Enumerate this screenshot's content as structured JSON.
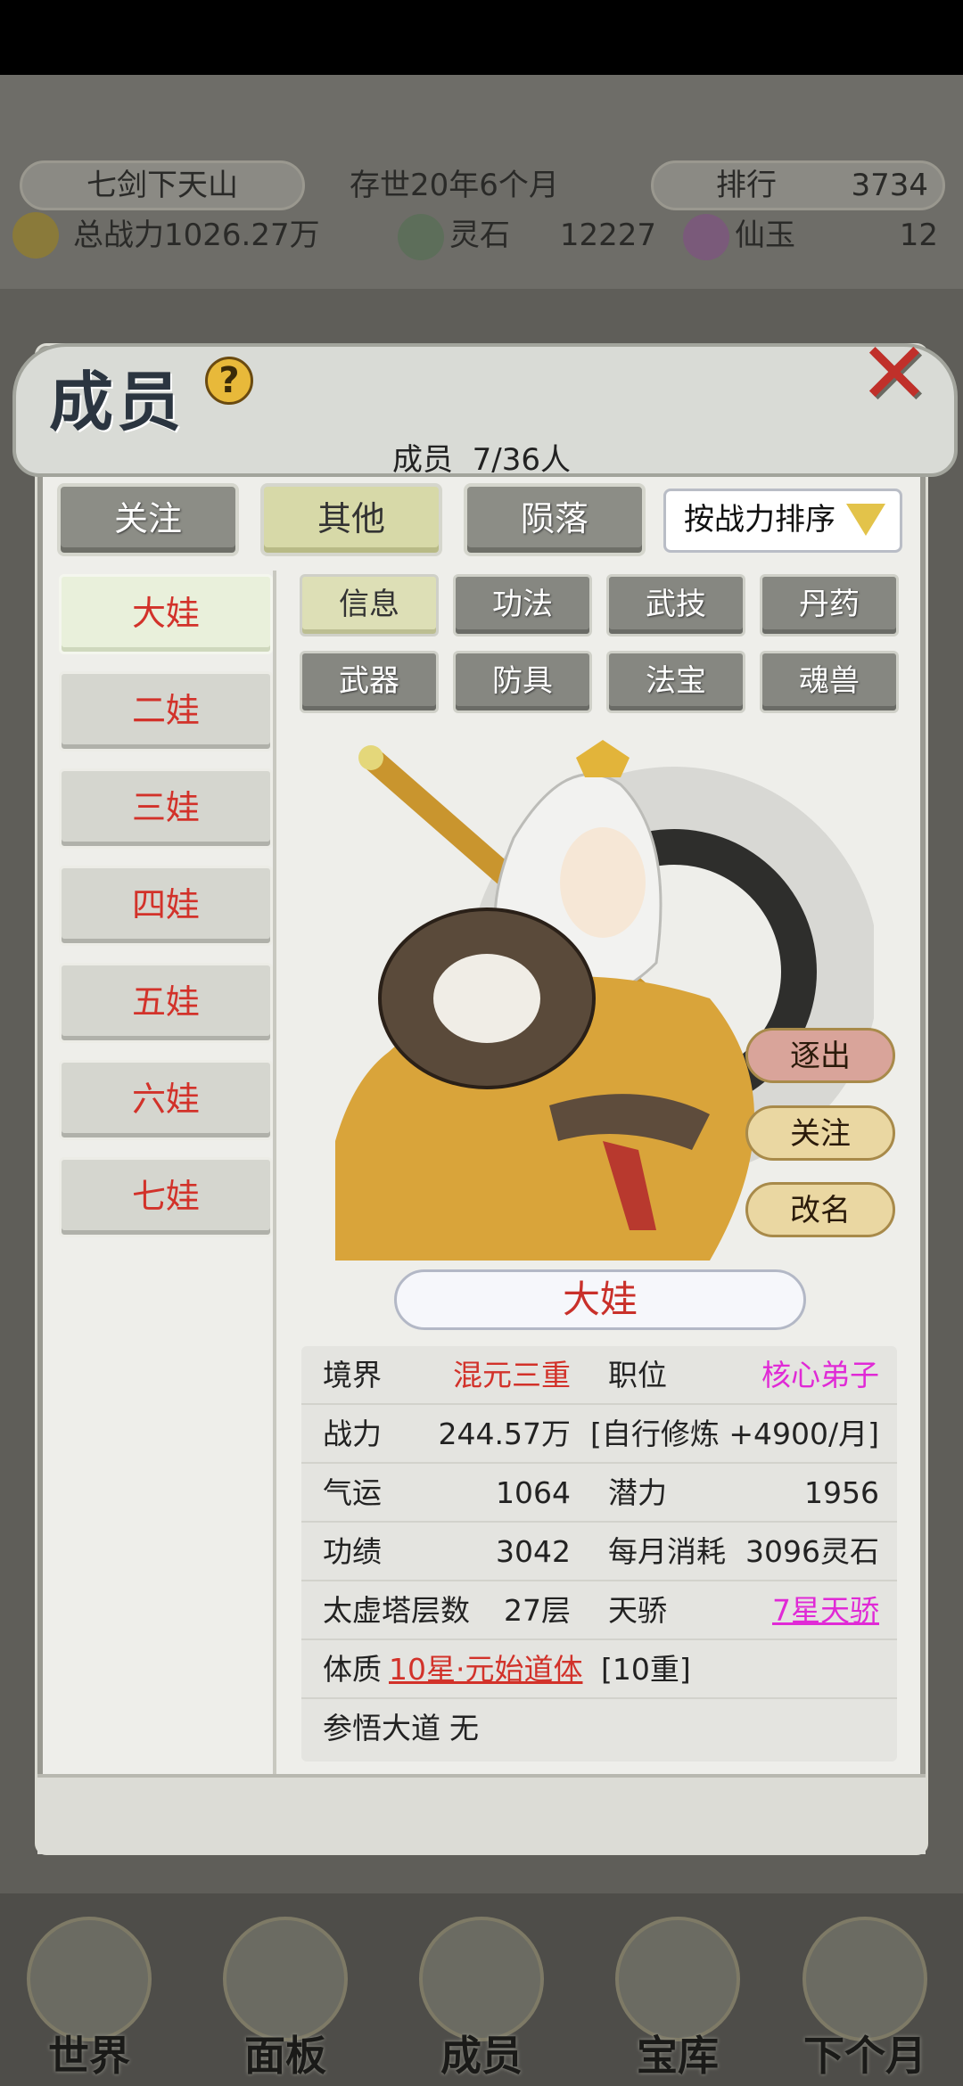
{
  "header": {
    "sect_name": "七剑下天山",
    "age_text": "存世20年6个月",
    "rank_label": "排行",
    "rank_value": "3734",
    "power_label": "总战力1026.27万",
    "spirit_stone_label": "灵石",
    "spirit_stone_value": "12227",
    "jade_label": "仙玉",
    "jade_value": "12"
  },
  "modal": {
    "title": "成员",
    "help": "?",
    "close": "✕",
    "member_count_label": "成员",
    "member_count_value": "7/36人",
    "tabs": [
      {
        "label": "关注"
      },
      {
        "label": "其他"
      },
      {
        "label": "陨落"
      }
    ],
    "selected_tab": "其他",
    "sort_label": "按战力排序",
    "members": [
      "大娃",
      "二娃",
      "三娃",
      "四娃",
      "五娃",
      "六娃",
      "七娃"
    ],
    "selected_member": "大娃",
    "subtabs": [
      "信息",
      "功法",
      "武技",
      "丹药",
      "武器",
      "防具",
      "法宝",
      "魂兽"
    ],
    "selected_subtab": "信息",
    "actions": {
      "expel": "逐出",
      "follow": "关注",
      "rename": "改名"
    },
    "character_name": "大娃",
    "stats": {
      "realm_label": "境界",
      "realm_value": "混元三重",
      "position_label": "职位",
      "position_value": "核心弟子",
      "power_label": "战力",
      "power_value": "244.57万",
      "cultivation_text": "[自行修炼 +4900/月]",
      "luck_label": "气运",
      "luck_value": "1064",
      "potential_label": "潜力",
      "potential_value": "1956",
      "merit_label": "功绩",
      "merit_value": "3042",
      "monthly_cost_label": "每月消耗",
      "monthly_cost_value": "3096灵石",
      "tower_label": "太虚塔层数",
      "tower_value": "27层",
      "talent_label": "天骄",
      "talent_value": "7星天骄",
      "physique_label": "体质",
      "physique_value": "10星·元始道体",
      "physique_level": "[10重]",
      "dao_label": "参悟大道",
      "dao_value": "无"
    }
  },
  "bottom_nav": [
    {
      "label": "世界"
    },
    {
      "label": "面板"
    },
    {
      "label": "成员"
    },
    {
      "label": "宝库"
    },
    {
      "label": "下个月"
    }
  ],
  "colors": {
    "accent_red": "#d2322a",
    "accent_pink": "#e02ad6",
    "tab_selected": "#d7d9a8"
  }
}
